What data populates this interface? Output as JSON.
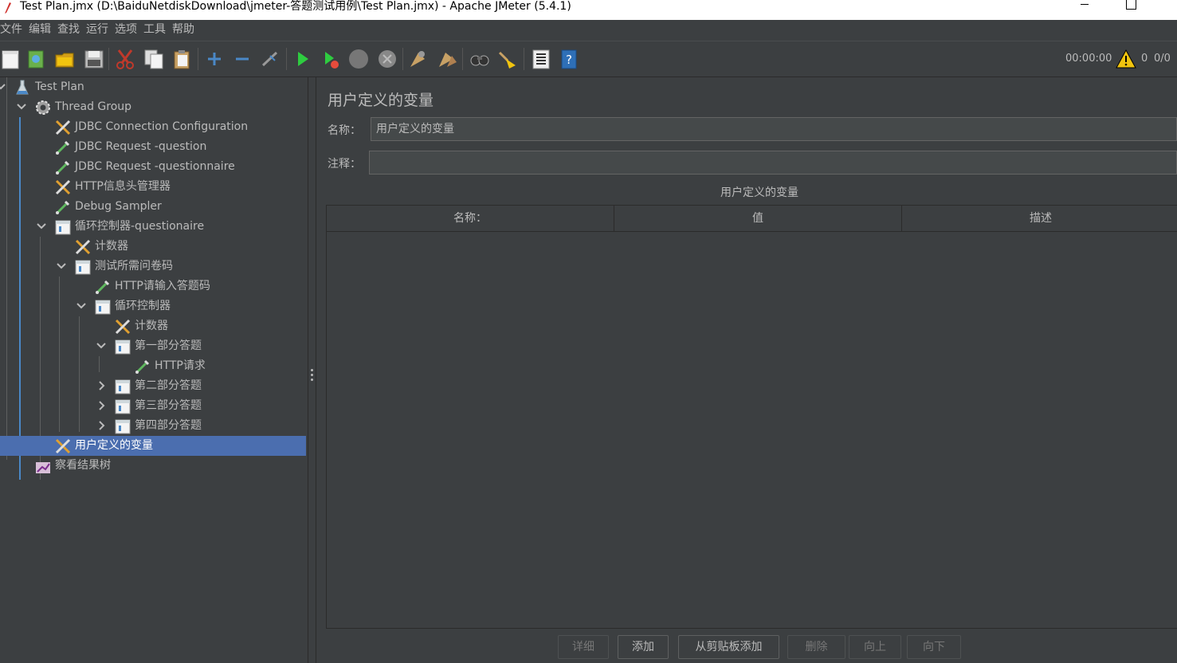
{
  "window": {
    "title": "Test Plan.jmx (D:\\BaiduNetdiskDownload\\jmeter-答题测试用例\\Test Plan.jmx) - Apache JMeter (5.4.1)"
  },
  "menu": [
    "文件",
    "编辑",
    "查找",
    "运行",
    "选项",
    "工具",
    "帮助"
  ],
  "toolbar": {
    "icons": [
      "new-icon",
      "templates-icon",
      "open-icon",
      "save-icon",
      "cut-icon",
      "copy-icon",
      "paste-icon",
      "expand-icon",
      "collapse-icon",
      "toggle-icon",
      "start-icon",
      "start-no-pause-icon",
      "stop-icon",
      "shutdown-icon",
      "clear-icon",
      "clear-all-icon",
      "search-icon",
      "reset-search-icon",
      "function-helper-icon",
      "help-icon"
    ],
    "elapsed_time": "00:00:00",
    "warning_count": "0",
    "threads": "0/0"
  },
  "tree": {
    "nodes": [
      {
        "label": "Test Plan",
        "icon": "test-plan-icon",
        "depth": 0,
        "arrow": "down"
      },
      {
        "label": "Thread Group",
        "icon": "thread-group-icon",
        "depth": 1,
        "arrow": "down"
      },
      {
        "label": "JDBC Connection Configuration",
        "icon": "config-element-icon",
        "depth": 2,
        "arrow": ""
      },
      {
        "label": "JDBC Request -question",
        "icon": "sampler-icon",
        "depth": 2,
        "arrow": ""
      },
      {
        "label": "JDBC Request -questionnaire",
        "icon": "sampler-icon",
        "depth": 2,
        "arrow": ""
      },
      {
        "label": "HTTP信息头管理器",
        "icon": "config-element-icon",
        "depth": 2,
        "arrow": ""
      },
      {
        "label": "Debug Sampler",
        "icon": "sampler-icon",
        "depth": 2,
        "arrow": ""
      },
      {
        "label": "循环控制器-questionaire",
        "icon": "controller-icon",
        "depth": 2,
        "arrow": "down"
      },
      {
        "label": "计数器",
        "icon": "config-element-icon",
        "depth": 3,
        "arrow": ""
      },
      {
        "label": "测试所需问卷码",
        "icon": "controller-icon",
        "depth": 3,
        "arrow": "down"
      },
      {
        "label": "HTTP请输入答题码",
        "icon": "sampler-icon",
        "depth": 4,
        "arrow": ""
      },
      {
        "label": "循环控制器",
        "icon": "controller-icon",
        "depth": 4,
        "arrow": "down"
      },
      {
        "label": "计数器",
        "icon": "config-element-icon",
        "depth": 5,
        "arrow": ""
      },
      {
        "label": "第一部分答题",
        "icon": "controller-icon",
        "depth": 5,
        "arrow": "down"
      },
      {
        "label": "HTTP请求",
        "icon": "sampler-icon",
        "depth": 6,
        "arrow": ""
      },
      {
        "label": "第二部分答题",
        "icon": "controller-icon",
        "depth": 5,
        "arrow": "right"
      },
      {
        "label": "第三部分答题",
        "icon": "controller-icon",
        "depth": 5,
        "arrow": "right"
      },
      {
        "label": "第四部分答题",
        "icon": "controller-icon",
        "depth": 5,
        "arrow": "right"
      },
      {
        "label": "用户定义的变量",
        "icon": "config-element-icon",
        "depth": 2,
        "arrow": "",
        "selected": true
      },
      {
        "label": "察看结果树",
        "icon": "listener-icon",
        "depth": 1,
        "arrow": ""
      }
    ]
  },
  "panel": {
    "title": "用户定义的变量",
    "name_label": "名称：",
    "name_value": "用户定义的变量",
    "comment_label": "注释：",
    "comment_value": "",
    "table_title": "用户定义的变量",
    "columns": [
      "名称：",
      "值",
      "描述"
    ],
    "buttons": [
      {
        "label": "详细",
        "enabled": false
      },
      {
        "label": "添加",
        "enabled": true
      },
      {
        "label": "从剪贴板添加",
        "enabled": true
      },
      {
        "label": "删除",
        "enabled": false
      },
      {
        "label": "向上",
        "enabled": false
      },
      {
        "label": "向下",
        "enabled": false
      }
    ]
  },
  "colors": {
    "background": "#3c3f41",
    "selection": "#4b6eaf",
    "tree_guide_active": "#4a88c7",
    "text": "#bbbbbb"
  }
}
